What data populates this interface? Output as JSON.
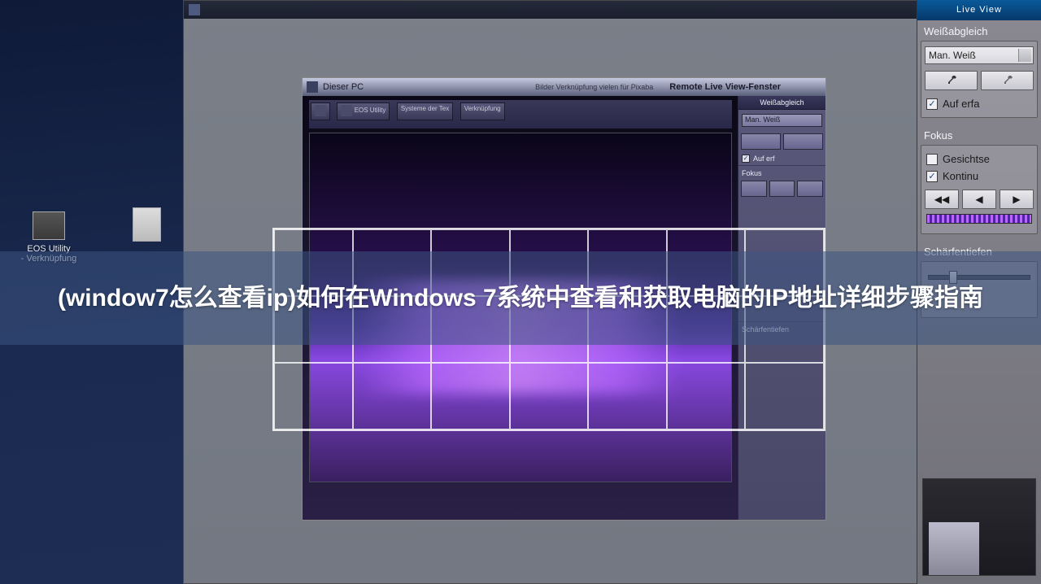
{
  "desktop": {
    "icons": [
      {
        "label": "EOS Utility"
      },
      {
        "label": "- Verknüpfung"
      }
    ]
  },
  "main_window": {},
  "inner_window": {
    "title_left": "Dieser PC",
    "title_meta": "Bilder   Verknüpfung   vielen für Pixaba",
    "title": "Remote Live View-Fenster",
    "side": {
      "head": "Weißabgleich",
      "dropdown": "Man. Weiß",
      "fokus": "Fokus",
      "cb1": "Auf erf",
      "sep2": "Schärfentiefen"
    },
    "taskbar_items": [
      "",
      "EOS Utility",
      "Systeme der Tex",
      "Verknüpfung"
    ]
  },
  "right_panel": {
    "header": "Live View",
    "wb_label": "Weißabgleich",
    "wb_value": "Man. Weiß",
    "cb_auferfa": "Auf erfa",
    "fokus_label": "Fokus",
    "cb_gesichts": "Gesichtse",
    "cb_kontinu": "Kontinu",
    "schaerfe_label": "Schärfentiefen"
  },
  "overlay": {
    "text": "(window7怎么查看ip)如何在Windows 7系统中查看和获取电脑的IP地址详细步骤指南"
  }
}
